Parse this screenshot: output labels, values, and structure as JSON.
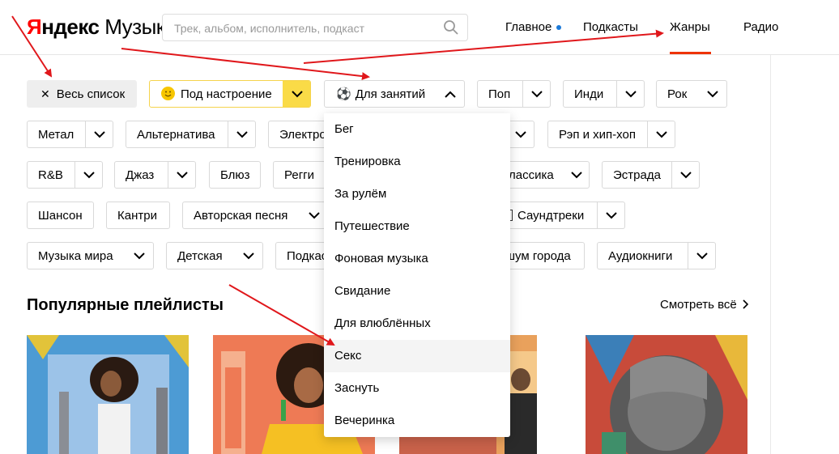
{
  "header": {
    "logo_part1": "Я",
    "logo_part2": "ндекс",
    "logo_part3": "Музыка",
    "search_placeholder": "Трек, альбом, исполнитель, подкаст",
    "nav": [
      "Главное",
      "Подкасты",
      "Жанры",
      "Радио"
    ],
    "active_nav": "Жанры",
    "active_color": "#ee3300",
    "dot_color": "#1c7ad9"
  },
  "chips": {
    "all_list": "Весь список",
    "mood": "Под настроение",
    "activities": "Для занятий",
    "pop": "Поп",
    "indie": "Инди",
    "rock": "Рок",
    "metal": "Метал",
    "alternative": "Альтернатива",
    "electronic": "Электро",
    "rap": "Рэп и хип-хоп",
    "rnb": "R&B",
    "jazz": "Джаз",
    "blues": "Блюз",
    "reggae": "Регги",
    "classic": "лассика",
    "estrada": "Эстрада",
    "chanson": "Шансон",
    "country": "Кантри",
    "bard": "Авторская песня",
    "soundtracks": "Саундтреки",
    "world": "Музыка мира",
    "kids": "Детская",
    "podcasts": "Подкас",
    "city_noise": "шум города",
    "audiobooks": "Аудиокниги",
    "mood_color": "#fadb47"
  },
  "dropdown": {
    "items": [
      "Бег",
      "Тренировка",
      "За рулём",
      "Путешествие",
      "Фоновая музыка",
      "Свидание",
      "Для влюблённых",
      "Секс",
      "Заснуть",
      "Вечеринка"
    ],
    "hovered_index": 7
  },
  "popular": {
    "title": "Популярные плейлисты",
    "see_all": "Смотреть всё"
  },
  "annotation_color": "#e0171b"
}
